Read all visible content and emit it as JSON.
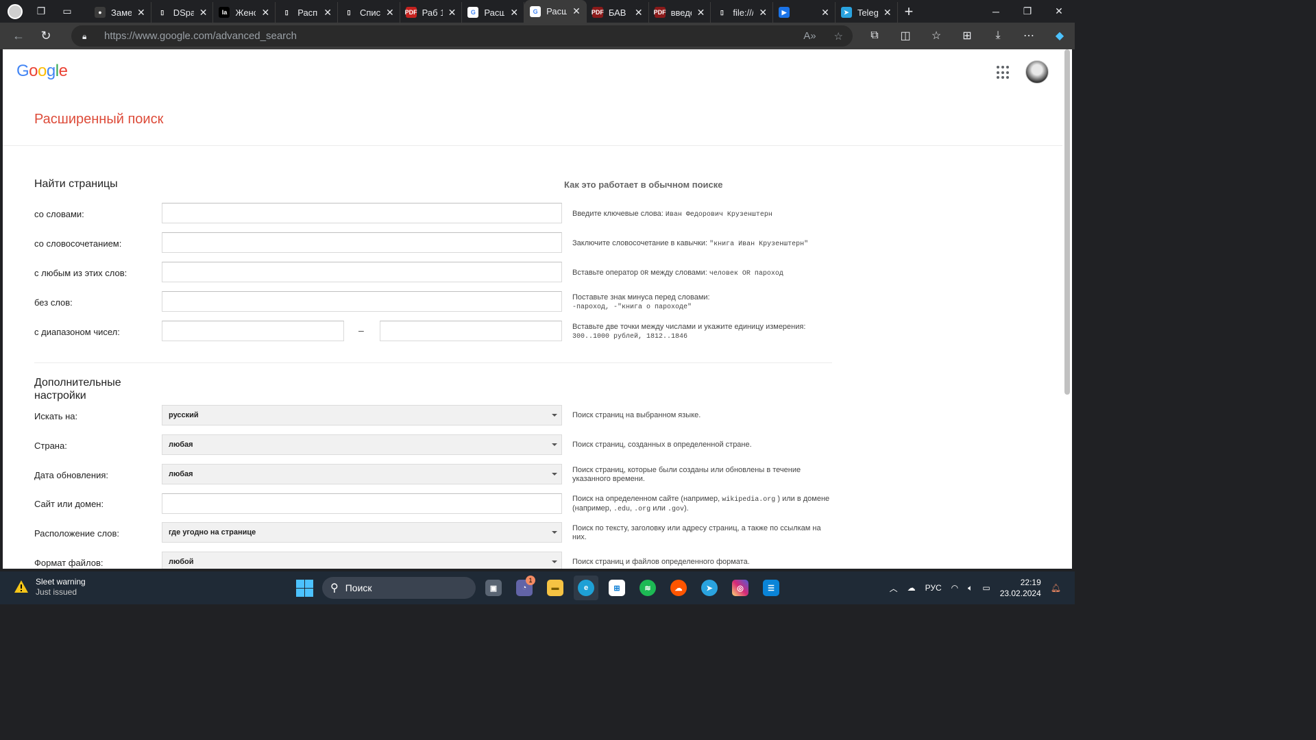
{
  "browser": {
    "tabs": [
      {
        "title": "Заметки",
        "favicon_color": "#3b3b3b",
        "favicon_glyph": "●"
      },
      {
        "title": "DSpace",
        "favicon_color": "#202124",
        "favicon_glyph": "▯"
      },
      {
        "title": "Женский",
        "favicon_color": "#000000",
        "favicon_glyph": "Ia"
      },
      {
        "title": "Распределение",
        "favicon_color": "#202124",
        "favicon_glyph": "▯"
      },
      {
        "title": "Список",
        "favicon_color": "#202124",
        "favicon_glyph": "▯"
      },
      {
        "title": "Раб 1",
        "favicon_color": "#c5221f",
        "favicon_glyph": "PDF"
      },
      {
        "title": "Расширенный",
        "favicon_color": "#ffffff",
        "favicon_glyph": "G"
      },
      {
        "title": "Расширенный",
        "favicon_color": "#ffffff",
        "favicon_glyph": "G",
        "active": true
      },
      {
        "title": "БАВ",
        "favicon_color": "#8b1a1a",
        "favicon_glyph": "PDF"
      },
      {
        "title": "введение",
        "favicon_color": "#8b1a1a",
        "favicon_glyph": "PDF"
      },
      {
        "title": "file:///",
        "favicon_color": "#202124",
        "favicon_glyph": "▯"
      },
      {
        "title": "",
        "favicon_color": "#1a73e8",
        "favicon_glyph": "▶"
      },
      {
        "title": "Telegram",
        "favicon_color": "#2aa3df",
        "favicon_glyph": "➤"
      }
    ],
    "url_host": "https://www.google.com",
    "url_path": "/advanced_search"
  },
  "google": {
    "logo": [
      "G",
      "o",
      "o",
      "g",
      "l",
      "e"
    ],
    "page_title": "Расширенный поиск"
  },
  "find_pages": {
    "heading": "Найти страницы",
    "how_heading": "Как это работает в обычном поиске",
    "rows": [
      {
        "label": "со словами:",
        "value": "",
        "hint": "Введите ключевые слова:",
        "hint_example": "Иван Федорович Крузенштерн"
      },
      {
        "label": "со словосочетанием:",
        "value": "",
        "hint": "Заключите словосочетание в кавычки:",
        "hint_example": "\"книга Иван Крузенштерн\""
      },
      {
        "label": "с любым из этих слов:",
        "value": "",
        "hint_pre": "Вставьте оператор",
        "hint_or": "OR",
        "hint_post": "между словами:",
        "hint_example": "человек OR пароход"
      },
      {
        "label": "без слов:",
        "value": "",
        "hint": "Поставьте знак минуса перед словами:",
        "hint_example": "-пароход, -\"книга о пароходе\""
      },
      {
        "label": "с диапазоном чисел:",
        "value_from": "",
        "value_to": "",
        "dash": "–",
        "hint": "Вставьте две точки между числами и укажите единицу измерения:",
        "hint_example": "300..1000 рублей, 1812..1846"
      }
    ]
  },
  "extra": {
    "heading_line1": "Дополнительные",
    "heading_line2": "настройки",
    "rows": [
      {
        "label": "Искать на:",
        "selected": "русский",
        "hint": "Поиск страниц на выбранном языке."
      },
      {
        "label": "Страна:",
        "selected": "любая",
        "hint": "Поиск страниц, созданных в определенной стране."
      },
      {
        "label": "Дата обновления:",
        "selected": "любая",
        "hint": "Поиск страниц, которые были созданы или обновлены в течение указанного времени."
      },
      {
        "label": "Сайт или домен:",
        "value": "",
        "hint_pre": "Поиск на определенном сайте (например,",
        "hint_code1": "wikipedia.org",
        "hint_mid": ") или в домене (например,",
        "hint_code2": ".edu",
        "hint_sep": ",",
        "hint_code3": ".org",
        "hint_or": "или",
        "hint_code4": ".gov",
        "hint_end": ")."
      },
      {
        "label": "Расположение слов:",
        "selected": "где угодно на странице",
        "hint": "Поиск по тексту, заголовку или адресу страниц, а также по ссылкам на них."
      },
      {
        "label": "Формат файлов:",
        "selected": "любой",
        "hint": "Поиск страниц и файлов определенного формата."
      }
    ]
  },
  "taskbar": {
    "weather_title": "Sleet warning",
    "weather_sub": "Just issued",
    "search_placeholder": "Поиск",
    "chat_badge": "1",
    "lang": "РУС",
    "time": "22:19",
    "date": "23.02.2024"
  }
}
